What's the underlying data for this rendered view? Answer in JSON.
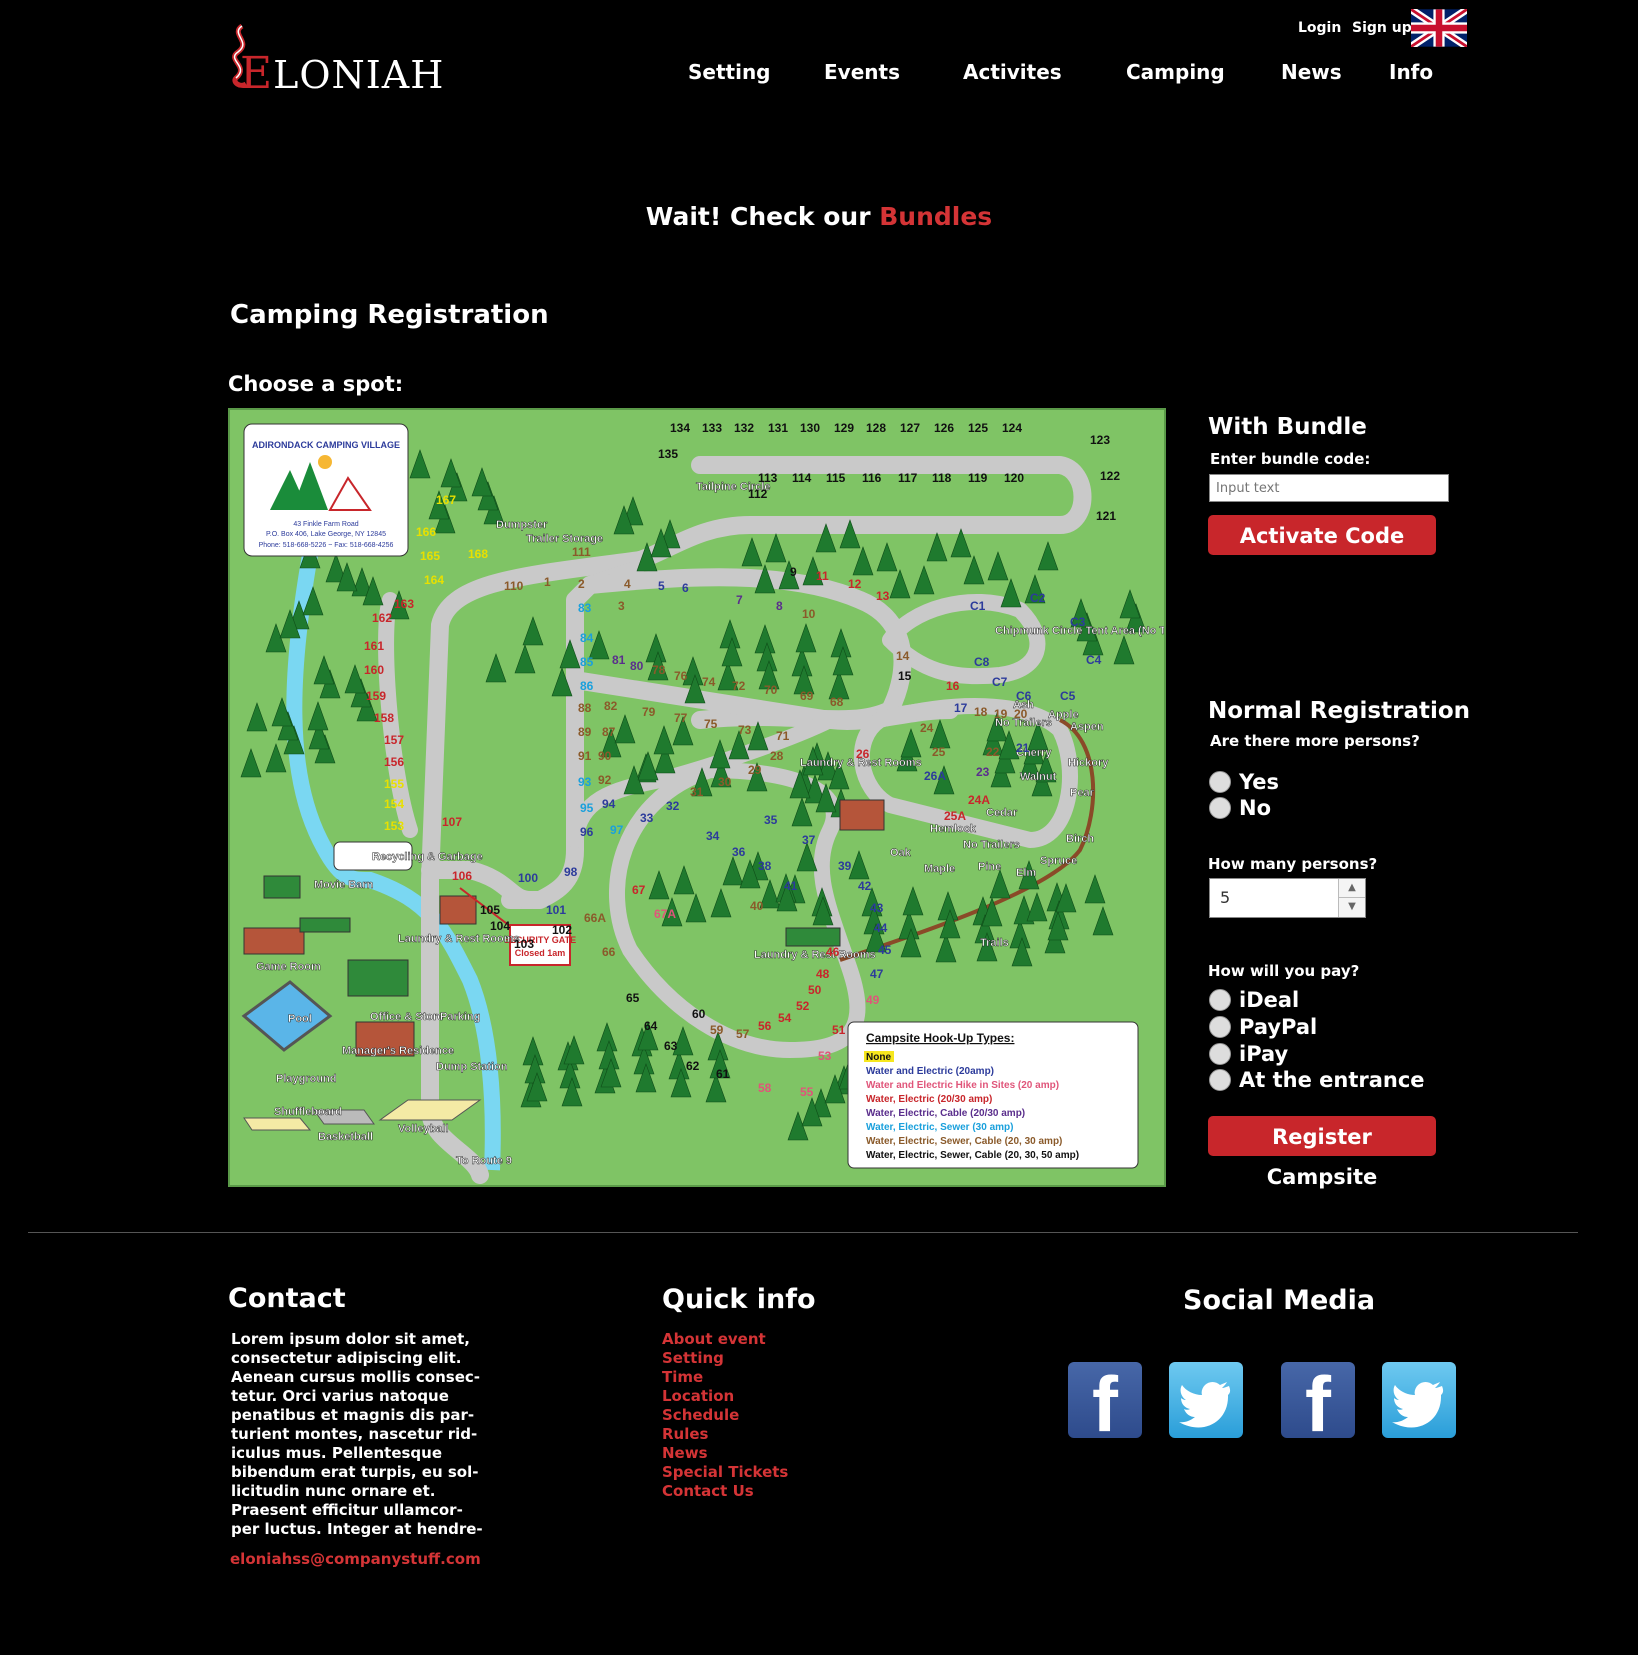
{
  "header": {
    "logo_text": "LONIAH",
    "logo_initial": "E",
    "login": "Login",
    "signup": "Sign up",
    "nav": [
      "Setting",
      "Events",
      "Activites",
      "Camping",
      "News",
      "Info"
    ]
  },
  "banner": {
    "prefix": "Wait! Check our ",
    "link": "Bundles"
  },
  "registration": {
    "title": "Camping Registration",
    "choose_spot": "Choose a spot:"
  },
  "map": {
    "logo_title": "ADIRONDACK CAMPING VILLAGE",
    "address1": "43 Finkle Farm Road",
    "address2": "P.O. Box 406, Lake George, NY 12845",
    "phone": "Phone: 518-668-5226 ~ Fax: 518-668-4256",
    "hookup_title": "Campsite Hook-Up Types:",
    "hookup_items": [
      {
        "label": "None",
        "color": "#e8e000"
      },
      {
        "label": "Water and Electric (20amp)",
        "color": "#2c3b9b"
      },
      {
        "label": "Water and Electric Hike in Sites (20 amp)",
        "color": "#e0557a"
      },
      {
        "label": "Water, Electric (20/30 amp)",
        "color": "#c8262b"
      },
      {
        "label": "Water, Electric, Cable (20/30 amp)",
        "color": "#5a2e8c"
      },
      {
        "label": "Water, Electric, Sewer (30 amp)",
        "color": "#1aa0dc"
      },
      {
        "label": "Water, Electric, Sewer, Cable (20, 30 amp)",
        "color": "#8a5a2a"
      },
      {
        "label": "Water, Electric, Sewer, Cable (20, 30, 50 amp)",
        "color": "#111111"
      }
    ],
    "places": [
      "Tailpine Circle",
      "Dumpster",
      "Trailer Storage",
      "Chipmunk Circle Tent Area (No Trailers)",
      "Recycling & Garbage",
      "Movie Barn",
      "Laundry & Rest Rooms",
      "Game Room",
      "Pool",
      "Office & Store",
      "Manager's Residence",
      "Playground",
      "Shuffleboard",
      "Basketball",
      "Volleyball",
      "Dump Station",
      "Parking",
      "To Route 9",
      "SECURITY GATE Closed 1am",
      "Laundry & Rest Rooms",
      "Laundry & Rest Rooms",
      "Trails",
      "No Trailers",
      "No Trailers",
      "Ash",
      "Apple",
      "Aspen",
      "Cherry",
      "Hickory",
      "Walnut",
      "Pear",
      "Cedar",
      "Hemlock",
      "Birch",
      "Spruce",
      "Oak",
      "Maple",
      "Pine",
      "Elm"
    ]
  },
  "bundle": {
    "title": "With Bundle",
    "code_label": "Enter bundle code:",
    "code_placeholder": "Input text",
    "activate_label": "Activate Code"
  },
  "normal": {
    "title": "Normal Registration",
    "more_persons_q": "Are there more persons?",
    "more_options": [
      "Yes",
      "No"
    ],
    "how_many_q": "How many persons?",
    "persons_value": "5",
    "pay_q": "How will you pay?",
    "pay_options": [
      "iDeal",
      "PayPal",
      "iPay",
      "At the entrance"
    ],
    "register_label": "Register Campsite"
  },
  "footer": {
    "contact_title": "Contact",
    "contact_body": "Lorem ipsum dolor sit amet, consectetur adipiscing elit. Aenean cursus mollis consec-tetur. Orci varius natoque penatibus et magnis dis par-turient montes, nascetur rid-iculus mus. Pellentesque bibendum erat turpis, eu sol-licitudin nunc ornare et. Praesent efficitur ullamcor-per luctus. Integer at hendre-",
    "email": "eloniahss@companystuff.com",
    "quick_title": "Quick info",
    "quick_links": [
      "About event",
      "Setting",
      "Time",
      "Location",
      "Schedule",
      "Rules",
      "News",
      "Special Tickets",
      "Contact Us"
    ],
    "social_title": "Social Media",
    "social_icons": [
      "facebook-icon",
      "twitter-icon",
      "facebook-icon",
      "twitter-icon"
    ]
  },
  "colors": {
    "accent": "#c8262b",
    "link": "#d43436",
    "map_green": "#7fc465"
  }
}
